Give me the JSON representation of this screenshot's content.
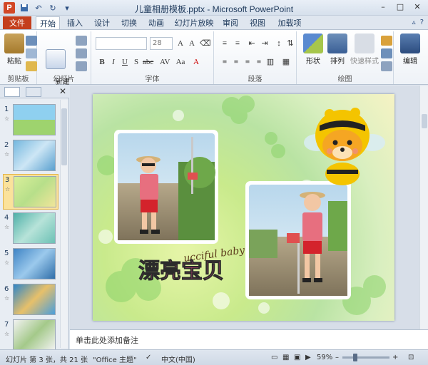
{
  "window": {
    "title": "儿童相册模板.pptx - Microsoft PowerPoint"
  },
  "tabs": {
    "file": "文件",
    "items": [
      "开始",
      "插入",
      "设计",
      "切换",
      "动画",
      "幻灯片放映",
      "审阅",
      "视图",
      "加载项"
    ],
    "active": "开始"
  },
  "ribbon": {
    "clipboard": {
      "label": "剪贴板",
      "paste": "粘贴"
    },
    "slides": {
      "label": "幻灯片",
      "new_slide": "新建\n幻灯片"
    },
    "font": {
      "label": "字体",
      "font_size": "28"
    },
    "paragraph": {
      "label": "段落"
    },
    "drawing": {
      "label": "绘图",
      "shapes": "形状",
      "arrange": "排列",
      "quick_styles": "快速样式"
    },
    "editing": {
      "label": "编辑",
      "edit": "编辑"
    }
  },
  "slides_panel": {
    "items": [
      {
        "num": "1",
        "star": "☆"
      },
      {
        "num": "2",
        "star": "☆"
      },
      {
        "num": "3",
        "star": "☆"
      },
      {
        "num": "4",
        "star": "☆"
      },
      {
        "num": "5",
        "star": "☆"
      },
      {
        "num": "6",
        "star": "☆"
      },
      {
        "num": "7",
        "star": "☆"
      }
    ],
    "selected": 3
  },
  "slide": {
    "curve_text": "ucciful baby",
    "title_word": "漂亮宝贝"
  },
  "notes": {
    "placeholder": "单击此处添加备注"
  },
  "status": {
    "slide_info": "幻灯片 第 3 张，共 21 张",
    "theme": "\"Office 主题\"",
    "language": "中文(中国)",
    "zoom": "59%"
  },
  "colors": {
    "file_tab": "#c43e1c",
    "accent": "#2a4d80"
  }
}
